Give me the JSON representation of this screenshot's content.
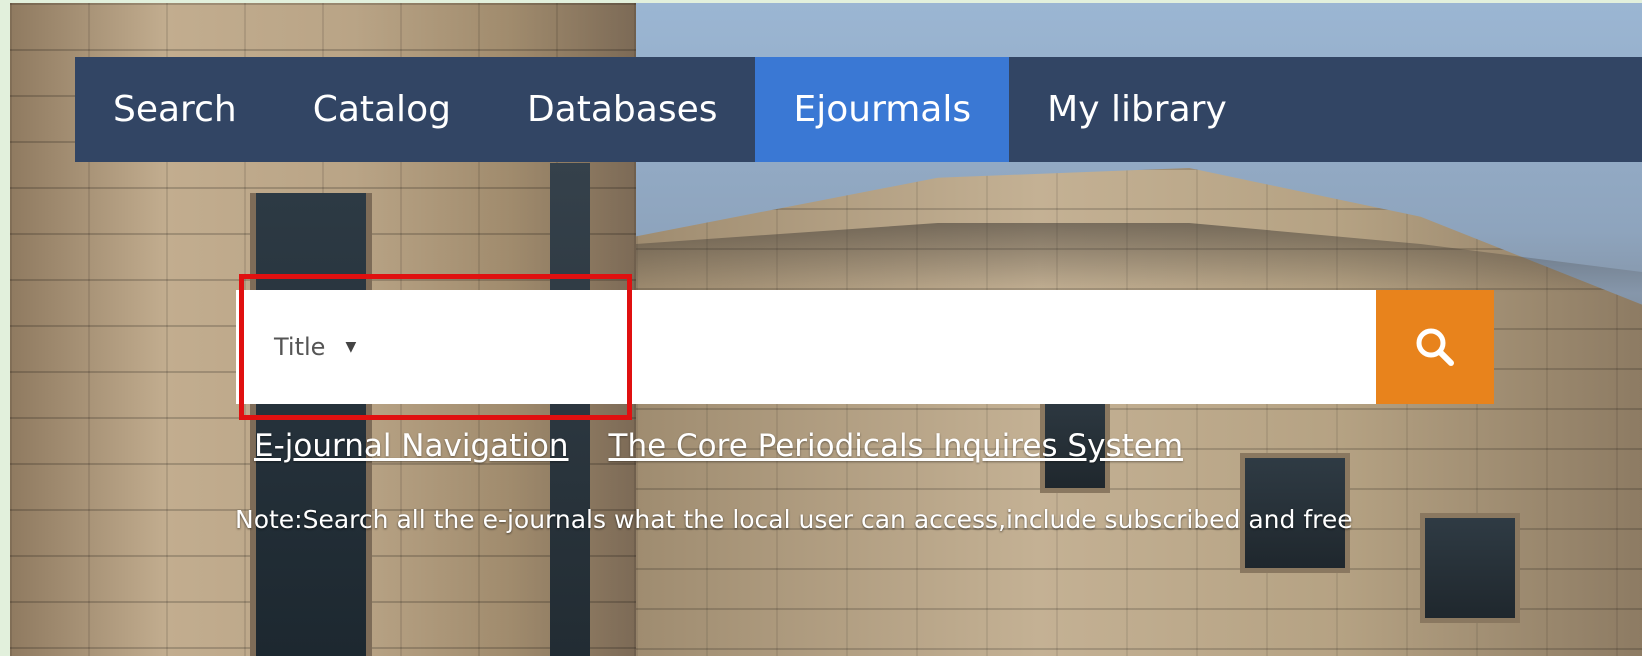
{
  "nav": {
    "items": [
      {
        "label": "Search"
      },
      {
        "label": "Catalog"
      },
      {
        "label": "Databases"
      },
      {
        "label": "Ejourmals"
      },
      {
        "label": "My library"
      }
    ],
    "active_index": 3
  },
  "search": {
    "type_label": "Title",
    "input_value": "",
    "button_icon": "search-icon"
  },
  "links": {
    "ejournal_nav": "E-journal Navigation",
    "core_periodicals": "The Core Periodicals Inquires System"
  },
  "note": "Note:Search all the e-journals what the local user can access,include subscribed and free",
  "colors": {
    "nav_bg": "#324564",
    "nav_active": "#3a78d4",
    "search_button": "#e8831c",
    "highlight": "#e01010"
  }
}
